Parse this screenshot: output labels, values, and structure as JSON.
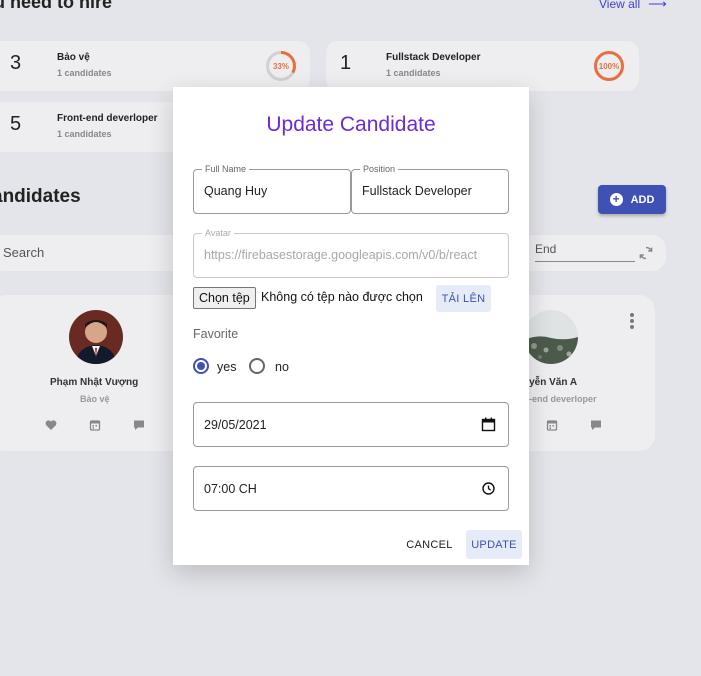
{
  "background": {
    "heading": "u need to hire",
    "view_all": "View all",
    "hire_cards": [
      {
        "count": "3",
        "title": "Bảo vệ",
        "sub": "1 candidates",
        "percent": "33%",
        "progress": 0.33
      },
      {
        "count": "1",
        "title": "Fullstack Developer",
        "sub": "1 candidates",
        "percent": "100%",
        "progress": 1.0
      },
      {
        "count": "5",
        "title": "Front-end deverloper",
        "sub": "1 candidates"
      }
    ],
    "section_title": "andidates",
    "add_label": "ADD",
    "search_placeholder": "Search",
    "end_label": "End",
    "candidates": [
      {
        "name": "Phạm Nhật Vượng",
        "role": "Bảo vệ"
      },
      {
        "name": "uyễn Văn A",
        "role": "-end deverloper"
      }
    ]
  },
  "dialog": {
    "title": "Update Candidate",
    "full_name": {
      "label": "Full Name",
      "value": "Quang Huy"
    },
    "position": {
      "label": "Position",
      "value": "Fullstack Developer"
    },
    "avatar": {
      "label": "Avatar",
      "value": "https://firebasestorage.googleapis.com/v0/b/react"
    },
    "file_button": "Chọn tệp",
    "file_status": "Không có tệp nào được chọn",
    "upload_label": "TẢI LÊN",
    "favorite_label": "Favorite",
    "favorite_options": [
      "yes",
      "no"
    ],
    "favorite_selected": "yes",
    "date_value": "29/05/2021",
    "time_value": "07:00 CH",
    "cancel_label": "CANCEL",
    "update_label": "UPDATE"
  },
  "colors": {
    "accent": "#3f51b5",
    "title_purple": "#6a2bd9",
    "progress_orange": "#e8703e",
    "background": "#e4e5ea"
  }
}
